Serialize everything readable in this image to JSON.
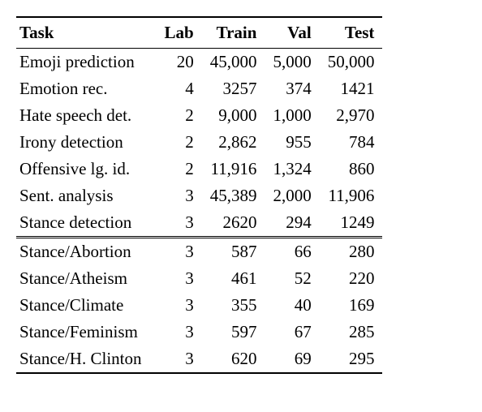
{
  "chart_data": {
    "type": "table",
    "columns": [
      "Task",
      "Lab",
      "Train",
      "Val",
      "Test"
    ],
    "sections": [
      {
        "rows": [
          {
            "task": "Emoji prediction",
            "lab": "20",
            "train": "45,000",
            "val": "5,000",
            "test": "50,000"
          },
          {
            "task": "Emotion rec.",
            "lab": "4",
            "train": "3257",
            "val": "374",
            "test": "1421"
          },
          {
            "task": "Hate speech det.",
            "lab": "2",
            "train": "9,000",
            "val": "1,000",
            "test": "2,970"
          },
          {
            "task": "Irony detection",
            "lab": "2",
            "train": "2,862",
            "val": "955",
            "test": "784"
          },
          {
            "task": "Offensive lg. id.",
            "lab": "2",
            "train": "11,916",
            "val": "1,324",
            "test": "860"
          },
          {
            "task": "Sent. analysis",
            "lab": "3",
            "train": "45,389",
            "val": "2,000",
            "test": "11,906"
          },
          {
            "task": "Stance detection",
            "lab": "3",
            "train": "2620",
            "val": "294",
            "test": "1249"
          }
        ]
      },
      {
        "rows": [
          {
            "task": "Stance/Abortion",
            "lab": "3",
            "train": "587",
            "val": "66",
            "test": "280"
          },
          {
            "task": "Stance/Atheism",
            "lab": "3",
            "train": "461",
            "val": "52",
            "test": "220"
          },
          {
            "task": "Stance/Climate",
            "lab": "3",
            "train": "355",
            "val": "40",
            "test": "169"
          },
          {
            "task": "Stance/Feminism",
            "lab": "3",
            "train": "597",
            "val": "67",
            "test": "285"
          },
          {
            "task": "Stance/H. Clinton",
            "lab": "3",
            "train": "620",
            "val": "69",
            "test": "295"
          }
        ]
      }
    ]
  }
}
